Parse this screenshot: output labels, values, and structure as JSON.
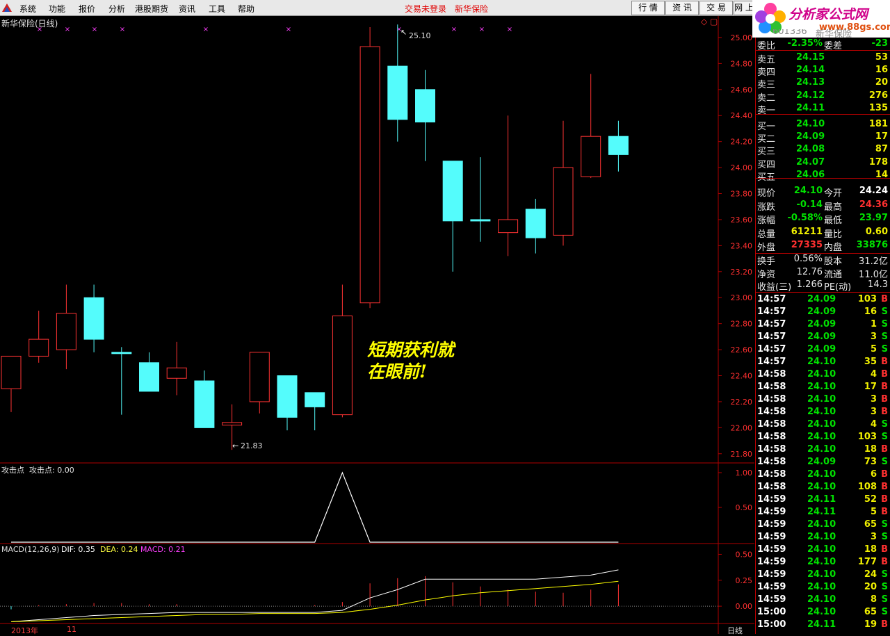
{
  "menu": {
    "items": [
      "系统",
      "功能",
      "报价",
      "分析",
      "港股期货",
      "资讯",
      "工具",
      "帮助"
    ],
    "trade_status": "交易未登录",
    "stock_name": "新华保险",
    "tabs": [
      "行 情",
      "资 讯",
      "交 易",
      "网 上"
    ]
  },
  "brand": {
    "name": "分析家公式网",
    "url": "www.88gs.com"
  },
  "price_panel": {
    "title": "新华保险(日线)",
    "high_label": "25.10",
    "low_label": "21.83",
    "axis_ticks": [
      "25.00",
      "24.80",
      "24.60",
      "24.40",
      "24.20",
      "24.00",
      "23.80",
      "23.60",
      "23.40",
      "23.20",
      "23.00",
      "22.80",
      "22.60",
      "22.40",
      "22.20",
      "22.00",
      "21.80"
    ],
    "callout_line1": "短期获利就",
    "callout_line2": "在眼前!"
  },
  "attack_panel": {
    "title": "攻击点",
    "value_label": "攻击点: 0.00",
    "axis_ticks": [
      "1.00",
      "0.50"
    ]
  },
  "macd_panel": {
    "title": "MACD(12,26,9)",
    "dif_label": "DIF: 0.35",
    "dea_label": "DEA: 0.24",
    "macd_label": "MACD: 0.21",
    "axis_ticks": [
      "0.50",
      "0.25",
      "0.00"
    ]
  },
  "xaxis": {
    "year": "2013年",
    "month": "11",
    "period": "日线"
  },
  "quote": {
    "header_code": "601336",
    "header_name": "新华保险",
    "wei_bi_label": "委比",
    "wei_bi_value": "-2.35%",
    "wei_cha_label": "委差",
    "wei_cha_value": "-23",
    "asks": [
      {
        "label": "卖五",
        "price": "24.15",
        "vol": "53"
      },
      {
        "label": "卖四",
        "price": "24.14",
        "vol": "16"
      },
      {
        "label": "卖三",
        "price": "24.13",
        "vol": "20"
      },
      {
        "label": "卖二",
        "price": "24.12",
        "vol": "276"
      },
      {
        "label": "卖一",
        "price": "24.11",
        "vol": "135"
      }
    ],
    "bids": [
      {
        "label": "买一",
        "price": "24.10",
        "vol": "181"
      },
      {
        "label": "买二",
        "price": "24.09",
        "vol": "17"
      },
      {
        "label": "买三",
        "price": "24.08",
        "vol": "87"
      },
      {
        "label": "买四",
        "price": "24.07",
        "vol": "178"
      },
      {
        "label": "买五",
        "price": "24.06",
        "vol": "14"
      }
    ],
    "stats": [
      {
        "l1": "现价",
        "v1": "24.10",
        "c1": "g",
        "l2": "今开",
        "v2": "24.24",
        "c2": "wb"
      },
      {
        "l1": "涨跌",
        "v1": "-0.14",
        "c1": "g",
        "l2": "最高",
        "v2": "24.36",
        "c2": "r"
      },
      {
        "l1": "涨幅",
        "v1": "-0.58%",
        "c1": "g",
        "l2": "最低",
        "v2": "23.97",
        "c2": "g"
      },
      {
        "l1": "总量",
        "v1": "61211",
        "c1": "y",
        "l2": "量比",
        "v2": "0.60",
        "c2": "y"
      },
      {
        "l1": "外盘",
        "v1": "27335",
        "c1": "r",
        "l2": "内盘",
        "v2": "33876",
        "c2": "g"
      }
    ],
    "fundamentals": [
      {
        "l1": "换手",
        "v1": "0.56%",
        "l2": "股本",
        "v2": "31.2亿"
      },
      {
        "l1": "净资",
        "v1": "12.76",
        "l2": "流通",
        "v2": "11.0亿"
      },
      {
        "l1": "收益(三)",
        "v1": "1.266",
        "l2": "PE(动)",
        "v2": "14.3"
      }
    ]
  },
  "ticks": [
    {
      "t": "14:57",
      "p": "24.09",
      "v": "103",
      "s": "B"
    },
    {
      "t": "14:57",
      "p": "24.09",
      "v": "16",
      "s": "S"
    },
    {
      "t": "14:57",
      "p": "24.09",
      "v": "1",
      "s": "S"
    },
    {
      "t": "14:57",
      "p": "24.09",
      "v": "3",
      "s": "S"
    },
    {
      "t": "14:57",
      "p": "24.09",
      "v": "5",
      "s": "S"
    },
    {
      "t": "14:57",
      "p": "24.10",
      "v": "35",
      "s": "B"
    },
    {
      "t": "14:58",
      "p": "24.10",
      "v": "4",
      "s": "B"
    },
    {
      "t": "14:58",
      "p": "24.10",
      "v": "17",
      "s": "B"
    },
    {
      "t": "14:58",
      "p": "24.10",
      "v": "3",
      "s": "B"
    },
    {
      "t": "14:58",
      "p": "24.10",
      "v": "3",
      "s": "B"
    },
    {
      "t": "14:58",
      "p": "24.10",
      "v": "4",
      "s": "S"
    },
    {
      "t": "14:58",
      "p": "24.10",
      "v": "103",
      "s": "S"
    },
    {
      "t": "14:58",
      "p": "24.10",
      "v": "18",
      "s": "B"
    },
    {
      "t": "14:58",
      "p": "24.09",
      "v": "73",
      "s": "S"
    },
    {
      "t": "14:58",
      "p": "24.10",
      "v": "6",
      "s": "B"
    },
    {
      "t": "14:58",
      "p": "24.10",
      "v": "108",
      "s": "B"
    },
    {
      "t": "14:59",
      "p": "24.11",
      "v": "52",
      "s": "B"
    },
    {
      "t": "14:59",
      "p": "24.11",
      "v": "5",
      "s": "B"
    },
    {
      "t": "14:59",
      "p": "24.10",
      "v": "65",
      "s": "S"
    },
    {
      "t": "14:59",
      "p": "24.10",
      "v": "3",
      "s": "S"
    },
    {
      "t": "14:59",
      "p": "24.10",
      "v": "18",
      "s": "B"
    },
    {
      "t": "14:59",
      "p": "24.10",
      "v": "177",
      "s": "B"
    },
    {
      "t": "14:59",
      "p": "24.10",
      "v": "24",
      "s": "S"
    },
    {
      "t": "14:59",
      "p": "24.10",
      "v": "20",
      "s": "S"
    },
    {
      "t": "14:59",
      "p": "24.10",
      "v": "8",
      "s": "S"
    },
    {
      "t": "15:00",
      "p": "24.10",
      "v": "65",
      "s": "S"
    },
    {
      "t": "15:00",
      "p": "24.11",
      "v": "19",
      "s": "B"
    }
  ],
  "colors": {
    "up": "#ff3333",
    "down": "#54fcfc",
    "bg": "#000000",
    "grid": "#b00000",
    "dif": "#ffffff",
    "dea": "#ffff00"
  },
  "chart_data": {
    "type": "candlestick",
    "candles": [
      {
        "o": 22.3,
        "h": 22.55,
        "l": 22.12,
        "c": 22.55
      },
      {
        "o": 22.55,
        "h": 22.9,
        "l": 22.5,
        "c": 22.68
      },
      {
        "o": 22.6,
        "h": 23.1,
        "l": 22.45,
        "c": 22.88
      },
      {
        "o": 23.0,
        "h": 23.1,
        "l": 22.58,
        "c": 22.68
      },
      {
        "o": 22.58,
        "h": 22.62,
        "l": 22.1,
        "c": 22.57
      },
      {
        "o": 22.5,
        "h": 22.58,
        "l": 22.28,
        "c": 22.28
      },
      {
        "o": 22.38,
        "h": 22.66,
        "l": 22.25,
        "c": 22.46
      },
      {
        "o": 22.36,
        "h": 22.44,
        "l": 22.0,
        "c": 22.0
      },
      {
        "o": 22.02,
        "h": 22.18,
        "l": 21.83,
        "c": 22.04
      },
      {
        "o": 22.2,
        "h": 22.58,
        "l": 22.11,
        "c": 22.58
      },
      {
        "o": 22.4,
        "h": 22.4,
        "l": 21.98,
        "c": 22.08
      },
      {
        "o": 22.27,
        "h": 22.27,
        "l": 21.98,
        "c": 22.16
      },
      {
        "o": 22.1,
        "h": 23.1,
        "l": 22.08,
        "c": 22.86
      },
      {
        "o": 22.96,
        "h": 25.08,
        "l": 22.92,
        "c": 24.93
      },
      {
        "o": 24.78,
        "h": 25.1,
        "l": 24.2,
        "c": 24.37
      },
      {
        "o": 24.6,
        "h": 24.75,
        "l": 24.05,
        "c": 24.35
      },
      {
        "o": 24.05,
        "h": 24.05,
        "l": 23.2,
        "c": 23.59
      },
      {
        "o": 23.6,
        "h": 24.08,
        "l": 23.43,
        "c": 23.59
      },
      {
        "o": 23.5,
        "h": 24.4,
        "l": 23.32,
        "c": 23.6
      },
      {
        "o": 23.68,
        "h": 23.76,
        "l": 23.34,
        "c": 23.46
      },
      {
        "o": 23.48,
        "h": 24.36,
        "l": 23.4,
        "c": 24.0
      },
      {
        "o": 23.93,
        "h": 24.72,
        "l": 23.92,
        "c": 24.24
      },
      {
        "o": 24.24,
        "h": 24.36,
        "l": 23.97,
        "c": 24.1
      }
    ],
    "price_range": [
      21.74,
      25.08
    ],
    "attack": [
      0,
      0,
      0,
      0,
      0,
      0,
      0,
      0,
      0,
      0,
      0,
      0,
      1,
      0,
      0,
      0,
      0,
      0,
      0,
      0,
      0,
      0,
      0
    ],
    "attack_range": [
      0,
      1.0
    ],
    "dif": [
      -0.15,
      -0.13,
      -0.11,
      -0.09,
      -0.08,
      -0.07,
      -0.06,
      -0.06,
      -0.06,
      -0.06,
      -0.06,
      -0.06,
      -0.04,
      0.08,
      0.16,
      0.26,
      0.26,
      0.26,
      0.26,
      0.26,
      0.28,
      0.3,
      0.35
    ],
    "dea": [
      -0.15,
      -0.14,
      -0.13,
      -0.12,
      -0.11,
      -0.1,
      -0.09,
      -0.08,
      -0.08,
      -0.07,
      -0.07,
      -0.07,
      -0.06,
      -0.03,
      0.01,
      0.06,
      0.1,
      0.13,
      0.15,
      0.17,
      0.19,
      0.21,
      0.24
    ],
    "macd": [
      -0.03,
      0.01,
      0.02,
      0.03,
      0.03,
      0.02,
      0.02,
      0.0,
      0.0,
      0.0,
      0.0,
      0.01,
      0.04,
      0.22,
      0.27,
      0.29,
      0.23,
      0.19,
      0.16,
      0.14,
      0.13,
      0.16,
      0.21
    ],
    "macd_range": [
      -0.16,
      0.55
    ]
  }
}
